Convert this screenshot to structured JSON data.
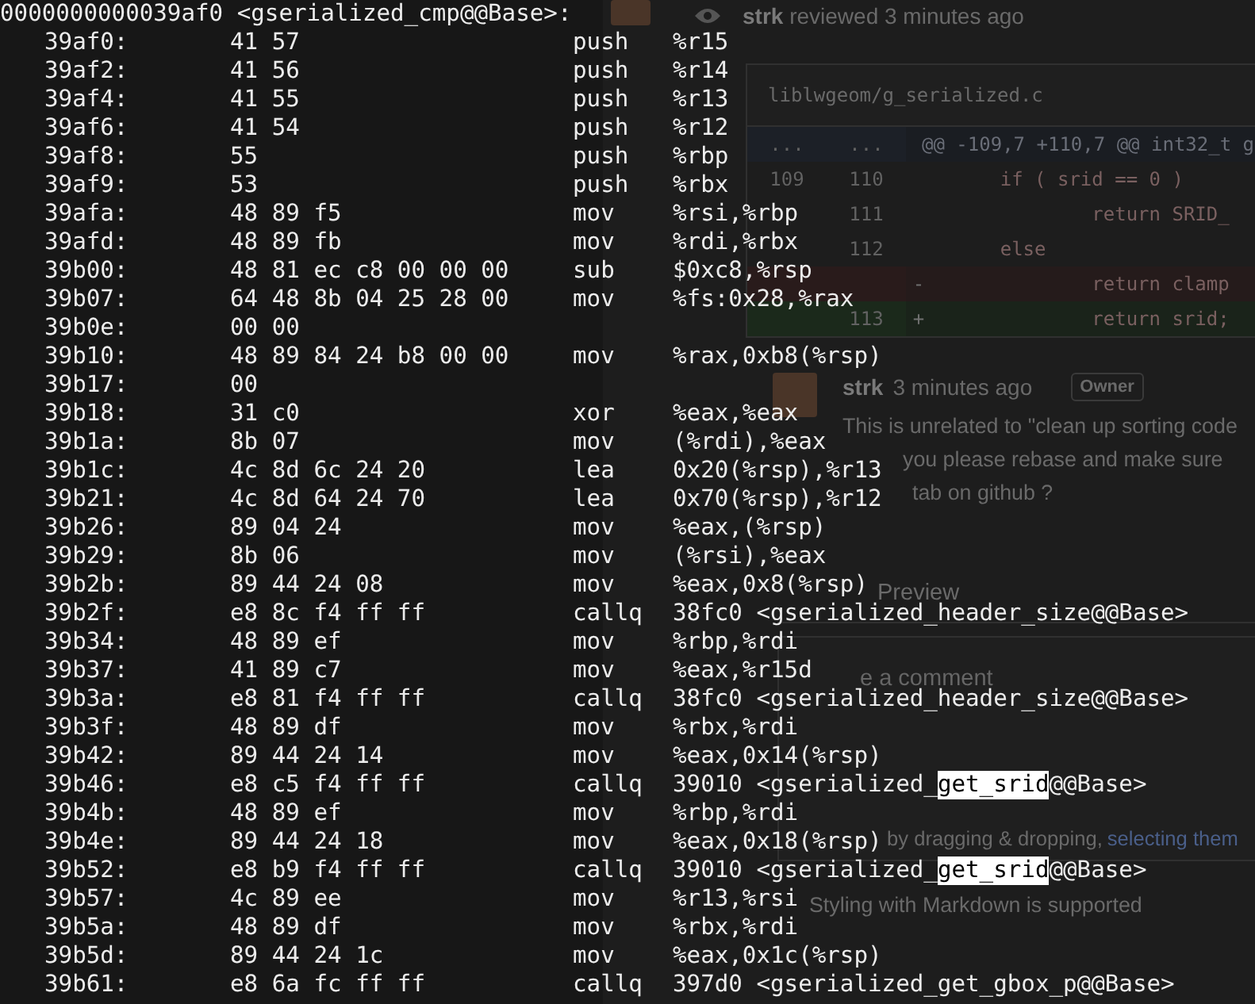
{
  "terminal": {
    "header": "0000000000039af0 <gserialized_cmp@@Base>:",
    "lines": [
      {
        "address": "39af0:",
        "bytes": "41 57",
        "mnemonic": "push",
        "operand": [
          {
            "text": "%r15",
            "highlighted": false
          }
        ]
      },
      {
        "address": "39af2:",
        "bytes": "41 56",
        "mnemonic": "push",
        "operand": [
          {
            "text": "%r14",
            "highlighted": false
          }
        ]
      },
      {
        "address": "39af4:",
        "bytes": "41 55",
        "mnemonic": "push",
        "operand": [
          {
            "text": "%r13",
            "highlighted": false
          }
        ]
      },
      {
        "address": "39af6:",
        "bytes": "41 54",
        "mnemonic": "push",
        "operand": [
          {
            "text": "%r12",
            "highlighted": false
          }
        ]
      },
      {
        "address": "39af8:",
        "bytes": "55",
        "mnemonic": "push",
        "operand": [
          {
            "text": "%rbp",
            "highlighted": false
          }
        ]
      },
      {
        "address": "39af9:",
        "bytes": "53",
        "mnemonic": "push",
        "operand": [
          {
            "text": "%rbx",
            "highlighted": false
          }
        ]
      },
      {
        "address": "39afa:",
        "bytes": "48 89 f5",
        "mnemonic": "mov",
        "operand": [
          {
            "text": "%rsi,%rbp",
            "highlighted": false
          }
        ]
      },
      {
        "address": "39afd:",
        "bytes": "48 89 fb",
        "mnemonic": "mov",
        "operand": [
          {
            "text": "%rdi,%rbx",
            "highlighted": false
          }
        ]
      },
      {
        "address": "39b00:",
        "bytes": "48 81 ec c8 00 00 00",
        "mnemonic": "sub",
        "operand": [
          {
            "text": "$0xc8,%rsp",
            "highlighted": false
          }
        ]
      },
      {
        "address": "39b07:",
        "bytes": "64 48 8b 04 25 28 00",
        "mnemonic": "mov",
        "operand": [
          {
            "text": "%fs:0x28,%rax",
            "highlighted": false
          }
        ]
      },
      {
        "address": "39b0e:",
        "bytes": "00 00"
      },
      {
        "address": "39b10:",
        "bytes": "48 89 84 24 b8 00 00",
        "mnemonic": "mov",
        "operand": [
          {
            "text": "%rax,0xb8(%rsp)",
            "highlighted": false
          }
        ]
      },
      {
        "address": "39b17:",
        "bytes": "00"
      },
      {
        "address": "39b18:",
        "bytes": "31 c0",
        "mnemonic": "xor",
        "operand": [
          {
            "text": "%eax,%eax",
            "highlighted": false
          }
        ]
      },
      {
        "address": "39b1a:",
        "bytes": "8b 07",
        "mnemonic": "mov",
        "operand": [
          {
            "text": "(%rdi),%eax",
            "highlighted": false
          }
        ]
      },
      {
        "address": "39b1c:",
        "bytes": "4c 8d 6c 24 20",
        "mnemonic": "lea",
        "operand": [
          {
            "text": "0x20(%rsp),%r13",
            "highlighted": false
          }
        ]
      },
      {
        "address": "39b21:",
        "bytes": "4c 8d 64 24 70",
        "mnemonic": "lea",
        "operand": [
          {
            "text": "0x70(%rsp),%r12",
            "highlighted": false
          }
        ]
      },
      {
        "address": "39b26:",
        "bytes": "89 04 24",
        "mnemonic": "mov",
        "operand": [
          {
            "text": "%eax,(%rsp)",
            "highlighted": false
          }
        ]
      },
      {
        "address": "39b29:",
        "bytes": "8b 06",
        "mnemonic": "mov",
        "operand": [
          {
            "text": "(%rsi),%eax",
            "highlighted": false
          }
        ]
      },
      {
        "address": "39b2b:",
        "bytes": "89 44 24 08",
        "mnemonic": "mov",
        "operand": [
          {
            "text": "%eax,0x8(%rsp)",
            "highlighted": false
          }
        ]
      },
      {
        "address": "39b2f:",
        "bytes": "e8 8c f4 ff ff",
        "mnemonic": "callq",
        "operand": [
          {
            "text": "38fc0 <gserialized_header_size@@Base>",
            "highlighted": false
          }
        ]
      },
      {
        "address": "39b34:",
        "bytes": "48 89 ef",
        "mnemonic": "mov",
        "operand": [
          {
            "text": "%rbp,%rdi",
            "highlighted": false
          }
        ]
      },
      {
        "address": "39b37:",
        "bytes": "41 89 c7",
        "mnemonic": "mov",
        "operand": [
          {
            "text": "%eax,%r15d",
            "highlighted": false
          }
        ]
      },
      {
        "address": "39b3a:",
        "bytes": "e8 81 f4 ff ff",
        "mnemonic": "callq",
        "operand": [
          {
            "text": "38fc0 <gserialized_header_size@@Base>",
            "highlighted": false
          }
        ]
      },
      {
        "address": "39b3f:",
        "bytes": "48 89 df",
        "mnemonic": "mov",
        "operand": [
          {
            "text": "%rbx,%rdi",
            "highlighted": false
          }
        ]
      },
      {
        "address": "39b42:",
        "bytes": "89 44 24 14",
        "mnemonic": "mov",
        "operand": [
          {
            "text": "%eax,0x14(%rsp)",
            "highlighted": false
          }
        ]
      },
      {
        "address": "39b46:",
        "bytes": "e8 c5 f4 ff ff",
        "mnemonic": "callq",
        "operand": [
          {
            "text": "39010 <gserialized_",
            "highlighted": false
          },
          {
            "text": "get_srid",
            "highlighted": true
          },
          {
            "text": "@@Base>",
            "highlighted": false
          }
        ]
      },
      {
        "address": "39b4b:",
        "bytes": "48 89 ef",
        "mnemonic": "mov",
        "operand": [
          {
            "text": "%rbp,%rdi",
            "highlighted": false
          }
        ]
      },
      {
        "address": "39b4e:",
        "bytes": "89 44 24 18",
        "mnemonic": "mov",
        "operand": [
          {
            "text": "%eax,0x18(%rsp)",
            "highlighted": false
          }
        ]
      },
      {
        "address": "39b52:",
        "bytes": "e8 b9 f4 ff ff",
        "mnemonic": "callq",
        "operand": [
          {
            "text": "39010 <gserialized_",
            "highlighted": false
          },
          {
            "text": "get_srid",
            "highlighted": true
          },
          {
            "text": "@@Base>",
            "highlighted": false
          }
        ]
      },
      {
        "address": "39b57:",
        "bytes": "4c 89 ee",
        "mnemonic": "mov",
        "operand": [
          {
            "text": "%r13,%rsi",
            "highlighted": false
          }
        ]
      },
      {
        "address": "39b5a:",
        "bytes": "48 89 df",
        "mnemonic": "mov",
        "operand": [
          {
            "text": "%rbx,%rdi",
            "highlighted": false
          }
        ]
      },
      {
        "address": "39b5d:",
        "bytes": "89 44 24 1c",
        "mnemonic": "mov",
        "operand": [
          {
            "text": "%eax,0x1c(%rsp)",
            "highlighted": false
          }
        ]
      },
      {
        "address": "39b61:",
        "bytes": "e8 6a fc ff ff",
        "mnemonic": "callq",
        "operand": [
          {
            "text": "397d0 <gserialized_get_gbox_p@@Base>",
            "highlighted": false
          }
        ]
      }
    ]
  },
  "review_page": {
    "review_event": {
      "author": "strk",
      "action": "reviewed 3 minutes ago"
    },
    "file": {
      "path": "liblwgeom/g_serialized.c",
      "diff": [
        {
          "kind": "hunk",
          "old": "...",
          "new": "...",
          "code": "@@ -109,7 +110,7 @@ int32_t g"
        },
        {
          "kind": "context",
          "old": "109",
          "new": "110",
          "code": "      if ( srid == 0 )"
        },
        {
          "kind": "context",
          "new": "111",
          "code": "              return SRID_"
        },
        {
          "kind": "context",
          "new": "112",
          "code": "      else"
        },
        {
          "kind": "deleted",
          "sign": "-",
          "code": "              return clamp"
        },
        {
          "kind": "added",
          "new": "113",
          "sign": "+",
          "code": "              return srid;"
        }
      ]
    },
    "comment": {
      "author": "strk",
      "time": "3 minutes ago",
      "badge": "Owner",
      "lines": [
        "This is unrelated to \"clean up sorting code",
        "you please rebase and make sure",
        "tab on github ?"
      ]
    },
    "editor": {
      "tabs": [
        {
          "label": "Preview",
          "selected": false
        }
      ],
      "placeholder": "e a comment",
      "attach_text": "by dragging & dropping,",
      "attach_link": "selecting them",
      "markdown_note": "Styling with Markdown is supported"
    }
  }
}
